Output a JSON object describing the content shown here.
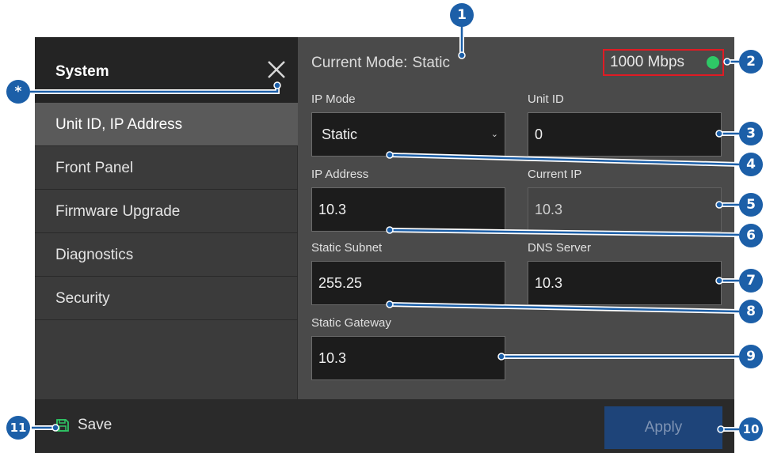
{
  "sidebar": {
    "title": "System",
    "items": [
      {
        "label": "Unit ID, IP Address"
      },
      {
        "label": "Front Panel"
      },
      {
        "label": "Firmware Upgrade"
      },
      {
        "label": "Diagnostics"
      },
      {
        "label": "Security"
      }
    ]
  },
  "status": {
    "mode_label": "Current Mode:",
    "mode_value": "Static",
    "speed": "1000 Mbps",
    "link_color": "#2ec866"
  },
  "fields": {
    "ip_mode": {
      "label": "IP Mode",
      "value": "Static"
    },
    "unit_id": {
      "label": "Unit ID",
      "value": "0"
    },
    "ip_address": {
      "label": "IP Address",
      "value": "10.3"
    },
    "current_ip": {
      "label": "Current IP",
      "value": "10.3"
    },
    "static_subnet": {
      "label": "Static Subnet",
      "value": "255.25"
    },
    "dns_server": {
      "label": "DNS Server",
      "value": "10.3"
    },
    "static_gateway": {
      "label": "Static Gateway",
      "value": "10.3"
    }
  },
  "footer": {
    "save_label": "Save",
    "apply_label": "Apply"
  },
  "callouts": [
    "1",
    "2",
    "3",
    "4",
    "5",
    "6",
    "7",
    "8",
    "9",
    "10",
    "11",
    "*"
  ],
  "colors": {
    "accent": "#1c5fa8",
    "highlight_box": "#e01b24"
  }
}
